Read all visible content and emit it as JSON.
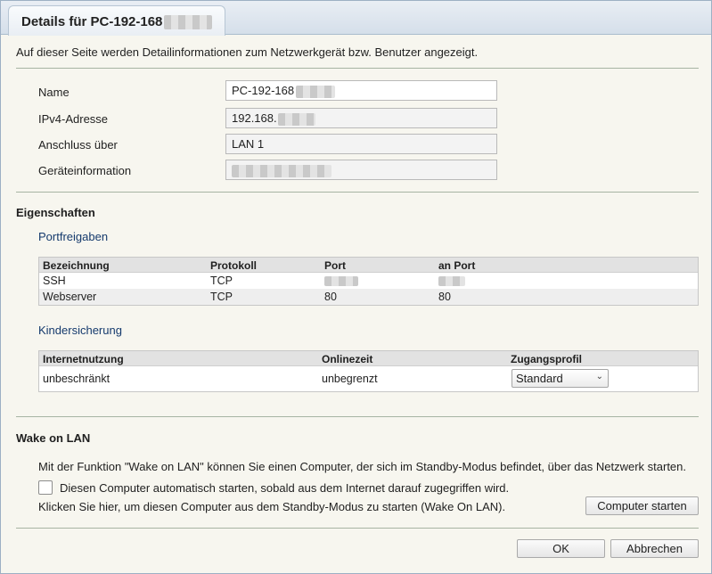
{
  "dialog": {
    "title": "Details für PC-192-168",
    "intro": "Auf dieser Seite werden Detailinformationen zum Netzwerkgerät bzw. Benutzer angezeigt."
  },
  "details": {
    "name_label": "Name",
    "name_value": "PC-192-168",
    "ipv4_label": "IPv4-Adresse",
    "ipv4_value": "192.168.",
    "connection_label": "Anschluss über",
    "connection_value": "LAN 1",
    "deviceinfo_label": "Geräteinformation",
    "deviceinfo_value": ""
  },
  "properties": {
    "title": "Eigenschaften",
    "portfreigaben": {
      "title": "Portfreigaben",
      "headers": [
        "Bezeichnung",
        "Protokoll",
        "Port",
        "an Port"
      ],
      "rows": [
        {
          "bezeichnung": "SSH",
          "protokoll": "TCP",
          "port": "",
          "an_port": ""
        },
        {
          "bezeichnung": "Webserver",
          "protokoll": "TCP",
          "port": "80",
          "an_port": "80"
        }
      ]
    },
    "kindersicherung": {
      "title": "Kindersicherung",
      "headers": [
        "Internetnutzung",
        "Onlinezeit",
        "Zugangsprofil"
      ],
      "row": {
        "internetnutzung": "unbeschränkt",
        "onlinezeit": "unbegrenzt",
        "zugangsprofil": "Standard"
      }
    }
  },
  "wol": {
    "title": "Wake on LAN",
    "description": "Mit der Funktion \"Wake on LAN\" können Sie einen Computer, der sich im Standby-Modus befindet, über das Netzwerk starten.",
    "checkbox_label": "Diesen Computer automatisch starten, sobald aus dem Internet darauf zugegriffen wird.",
    "checkbox_checked": false,
    "start_hint": "Klicken Sie hier, um diesen Computer aus dem Standby-Modus zu starten (Wake On LAN).",
    "start_button": "Computer starten"
  },
  "footer": {
    "ok": "OK",
    "cancel": "Abbrechen"
  },
  "icons": {
    "dropdown": "chevron-down-icon"
  }
}
